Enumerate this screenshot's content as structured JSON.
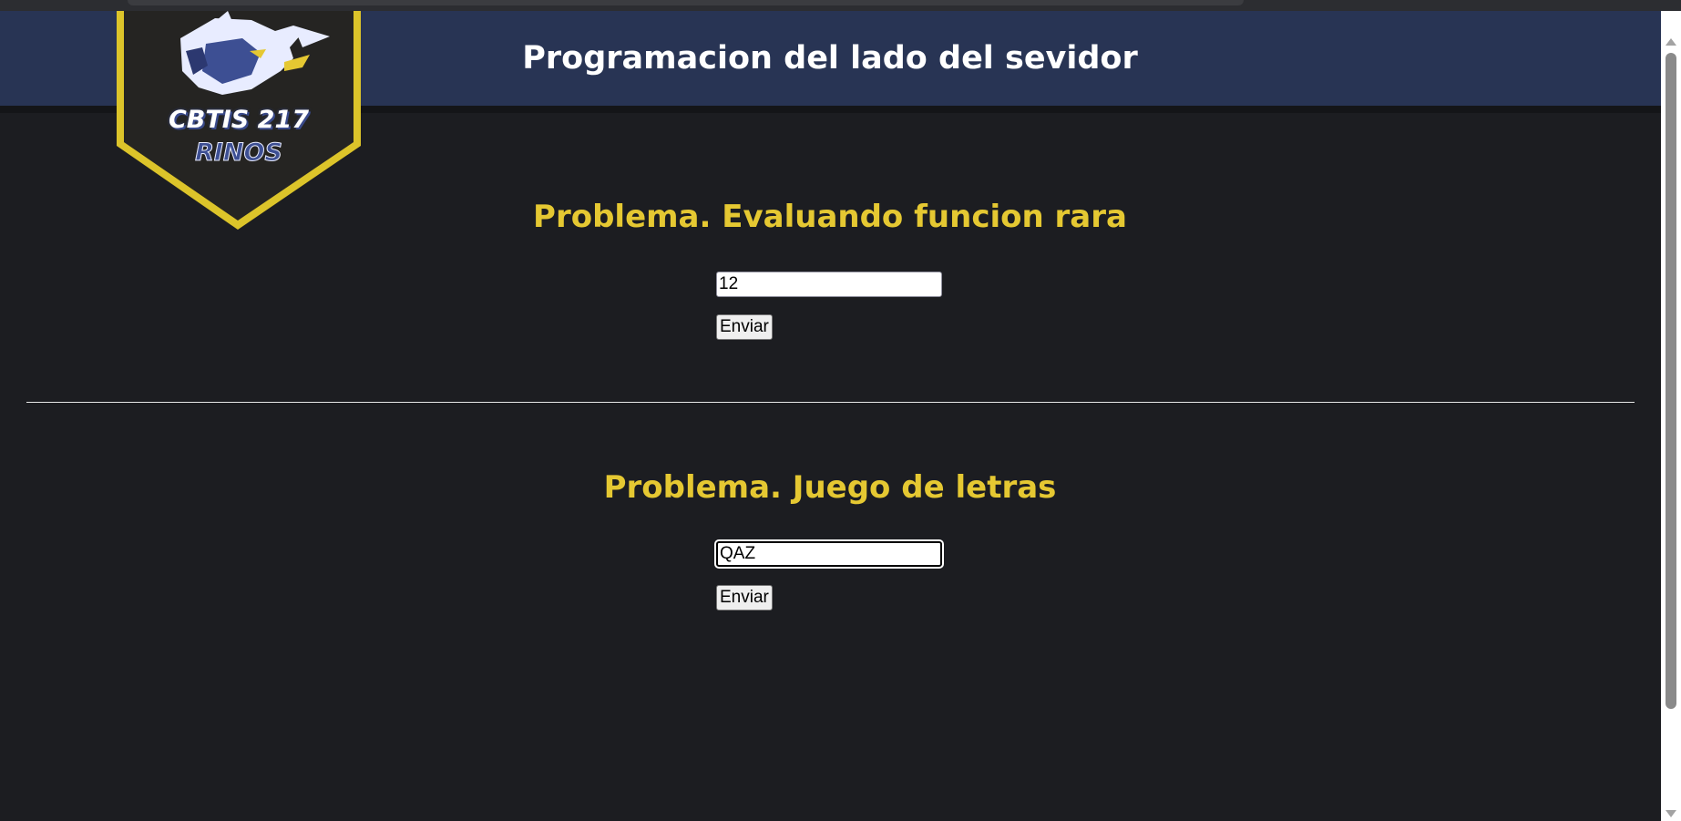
{
  "header": {
    "title": "Programacion del lado del sevidor"
  },
  "logo": {
    "line1": "CBTIS 217",
    "line2": "RINOS",
    "icon": "rhino-icon",
    "colors": {
      "banner_bg": "#252422",
      "border": "#dcc42a",
      "accent": "#3d4f93"
    }
  },
  "problems": [
    {
      "title": "Problema. Evaluando funcion rara",
      "input_value": "12",
      "button_label": "Enviar"
    },
    {
      "title": "Problema. Juego de letras",
      "input_value": "QAZ",
      "button_label": "Enviar"
    }
  ],
  "colors": {
    "page_bg": "#1c1d21",
    "header_bg": "#283454",
    "title_accent": "#e5c832"
  }
}
